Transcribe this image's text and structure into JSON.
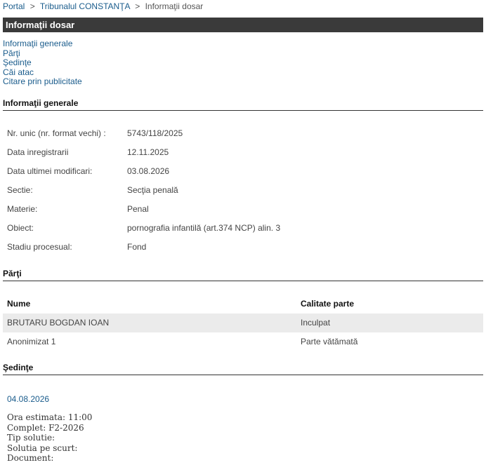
{
  "breadcrumb": {
    "portal": "Portal",
    "court": "Tribunalul CONSTANŢA",
    "current": "Informaţii dosar",
    "separator": ">"
  },
  "title_bar": "Informaţii dosar",
  "toc": [
    "Informaţii generale",
    "Părţi",
    "Şedinţe",
    "Căi atac",
    "Citare prin publicitate"
  ],
  "sections": {
    "general": "Informaţii generale",
    "parti": "Părţi",
    "sedinte": "Şedinţe"
  },
  "general_info": [
    {
      "label": "Nr. unic (nr. format vechi) :",
      "value": "5743/118/2025"
    },
    {
      "label": "Data inregistrarii",
      "value": "12.11.2025"
    },
    {
      "label": "Data ultimei modificari:",
      "value": "03.08.2026"
    },
    {
      "label": "Sectie:",
      "value": "Secţia penală"
    },
    {
      "label": "Materie:",
      "value": "Penal"
    },
    {
      "label": "Obiect:",
      "value": "pornografia infantilă (art.374 NCP) alin. 3"
    },
    {
      "label": "Stadiu procesual:",
      "value": "Fond"
    }
  ],
  "parti": {
    "headers": {
      "name": "Nume",
      "role": "Calitate parte"
    },
    "rows": [
      {
        "name": "BRUTARU BOGDAN IOAN",
        "role": "Inculpat"
      },
      {
        "name": "Anonimizat 1",
        "role": "Parte vătămată"
      }
    ]
  },
  "sedinta": {
    "date": "04.08.2026",
    "details": [
      "Ora estimata: 11:00",
      "Complet: F2-2026",
      "Tip solutie:",
      "Solutia pe scurt:",
      "Document:"
    ]
  }
}
